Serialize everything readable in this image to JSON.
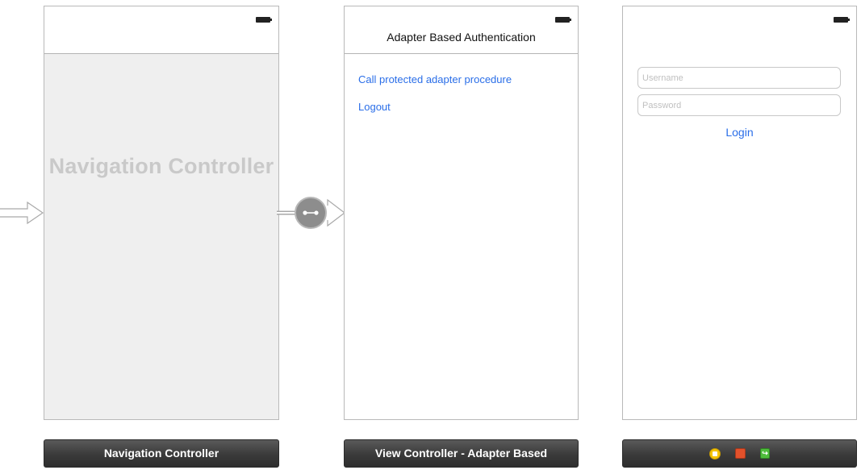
{
  "scenes": {
    "navigation": {
      "watermark": "Navigation Controller",
      "dock_label": "Navigation Controller"
    },
    "adapter": {
      "title": "Adapter Based Authentication",
      "links": [
        "Call protected adapter procedure",
        "Logout"
      ],
      "dock_label": "View Controller - Adapter Based"
    },
    "login": {
      "username_placeholder": "Username",
      "password_placeholder": "Password",
      "login_label": "Login",
      "dock_icons": [
        "first-responder-icon",
        "cube-icon",
        "exit-icon"
      ]
    }
  },
  "colors": {
    "link": "#2a6ee8",
    "watermark": "#c9c9c9",
    "dock": "#3a3a3a"
  }
}
